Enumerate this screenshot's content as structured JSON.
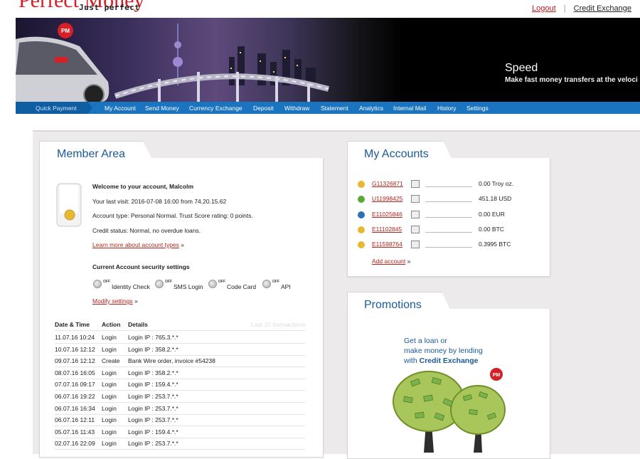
{
  "brand": {
    "logo": "Perfect Money",
    "tagline": "Just perfect"
  },
  "header_links": {
    "logout": "Logout",
    "separator": "|",
    "credit_exchange": "Credit Exchange"
  },
  "banner": {
    "title": "Speed",
    "subtitle": "Make fast money transfers at the veloci",
    "pm_badge": "PM"
  },
  "nav": {
    "quick_payment": "Quick Payment",
    "items": [
      "My Account",
      "Send Money",
      "Currency Exchange",
      "Deposit",
      "Withdraw",
      "Statement",
      "Analytics",
      "Internal Mail",
      "History",
      "Settings"
    ]
  },
  "member_area": {
    "title": "Member Area",
    "welcome": "Welcome to your account, Malcolm",
    "last_visit": "Your last visit: 2016-07-08 16:00 from 74.20.15.62",
    "account_type": "Account type: Personal Normal. Trust Score rating: 0 points.",
    "credit_status": "Credit status: Normal, no overdue loans.",
    "learn_more": "Learn more about account types",
    "raquo": "»",
    "security_title": "Current Account security settings",
    "security_items": [
      {
        "label": "Identity Check",
        "state": "OFF"
      },
      {
        "label": "SMS Login",
        "state": "OFF"
      },
      {
        "label": "Code Card",
        "state": "OFF"
      },
      {
        "label": "API",
        "state": "OFF"
      }
    ],
    "modify": "Modify settings",
    "table": {
      "headers": [
        "Date & Time",
        "Action",
        "Details"
      ],
      "caption": "Last 10 transactions",
      "rows": [
        [
          "11.07.16 10:24",
          "Login",
          "Login IP : 765.3.*.*"
        ],
        [
          "10.07.16 12:12",
          "Login",
          "Login IP : 358.2.*.*"
        ],
        [
          "09.07.16 12:12",
          "Create",
          "Bank Wire order, invoice #54238"
        ],
        [
          "08.07.16 16:05",
          "Login",
          "Login IP : 358.2.*.*"
        ],
        [
          "07.07.16 09:17",
          "Login",
          "Login IP : 159.4.*.*"
        ],
        [
          "06.07.16 19:22",
          "Login",
          "Login IP : 253.7.*.*"
        ],
        [
          "06.07.16 16:34",
          "Login",
          "Login IP : 253.7.*.*"
        ],
        [
          "06.07.16 12:11",
          "Login",
          "Login IP : 253.7.*.*"
        ],
        [
          "05.07.16 11:43",
          "Login",
          "Login IP : 159.4.*.*"
        ],
        [
          "02.07.16 22:09",
          "Login",
          "Login IP : 253.7.*.*"
        ]
      ]
    }
  },
  "my_accounts": {
    "title": "My Accounts",
    "accounts": [
      {
        "id": "G11326871",
        "balance": "0.00 Troy oz.",
        "icon": "gold-icon",
        "color": "#e8b832"
      },
      {
        "id": "U11998425",
        "balance": "451.18 USD",
        "icon": "usd-icon",
        "color": "#5aa83a"
      },
      {
        "id": "E11025846",
        "balance": "0.00 EUR",
        "icon": "eur-icon",
        "color": "#2e6fb6"
      },
      {
        "id": "E11102845",
        "balance": "0.00 BTC",
        "icon": "btc-icon",
        "color": "#e8b832"
      },
      {
        "id": "E11598764",
        "balance": "0.3995 BTC",
        "icon": "btc-icon",
        "color": "#e8b832"
      }
    ],
    "add_account": "Add account",
    "raquo": "»"
  },
  "promotions": {
    "title": "Promotions",
    "line1": "Get a loan or",
    "line2": "make money by lending",
    "line3_prefix": "with",
    "line3_bold": "Credit Exchange",
    "badge": "PM"
  },
  "colors": {
    "brand_red": "#d62027",
    "nav_blue": "#1b74c0",
    "title_blue": "#1a5a96",
    "link_red": "#b3261e"
  }
}
